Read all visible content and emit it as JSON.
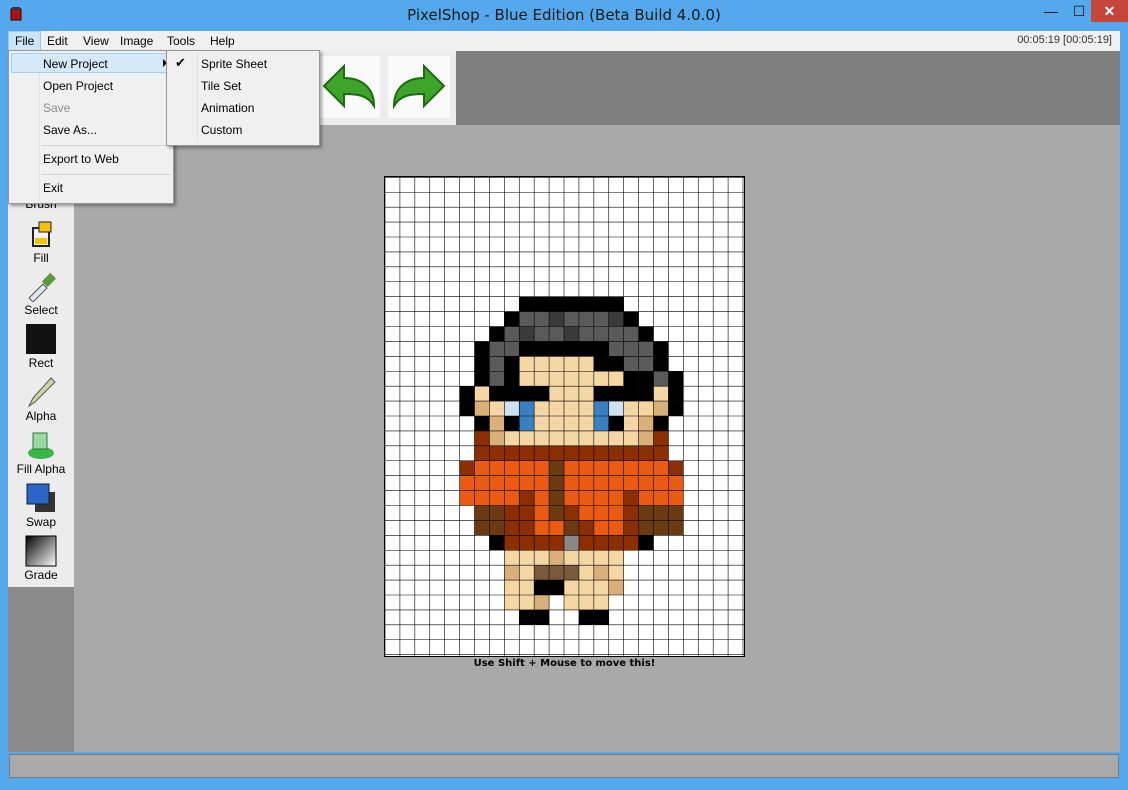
{
  "window": {
    "title": "PixelShop - Blue Edition (Beta Build 4.0.0)",
    "minimize_glyph": "—",
    "maximize_glyph": "☐",
    "close_glyph": "✕",
    "icon": "paint-bucket-icon"
  },
  "menubar": {
    "items": [
      "File",
      "Edit",
      "View",
      "Image",
      "Tools",
      "Help"
    ],
    "clock": "00:05:19 [00:05:19]"
  },
  "file_menu": {
    "items": [
      {
        "label": "New Project",
        "enabled": true,
        "has_submenu": true
      },
      {
        "label": "Open Project",
        "enabled": true
      },
      {
        "label": "Save",
        "enabled": false
      },
      {
        "label": "Save As...",
        "enabled": true
      },
      {
        "label": "Export to Web",
        "enabled": true
      },
      {
        "label": "Exit",
        "enabled": true
      }
    ]
  },
  "new_project_submenu": {
    "items": [
      {
        "label": "Sprite Sheet",
        "checked": true
      },
      {
        "label": "Tile Set",
        "checked": false
      },
      {
        "label": "Animation",
        "checked": false
      },
      {
        "label": "Custom",
        "checked": false
      }
    ],
    "check_glyph": "✔"
  },
  "toolbar": {
    "undo_icon": "undo-arrow-icon",
    "redo_icon": "redo-arrow-icon",
    "arrow_color": "#3fa52a"
  },
  "tools": [
    {
      "label": "Brush",
      "icon": "brush-icon"
    },
    {
      "label": "Fill",
      "icon": "paint-bucket-icon"
    },
    {
      "label": "Select",
      "icon": "eyedropper-icon"
    },
    {
      "label": "Rect",
      "icon": "rectangle-icon"
    },
    {
      "label": "Alpha",
      "icon": "pencil-icon"
    },
    {
      "label": "Fill Alpha",
      "icon": "green-bucket-icon"
    },
    {
      "label": "Swap",
      "icon": "swap-colors-icon"
    },
    {
      "label": "Grade",
      "icon": "gradient-icon"
    }
  ],
  "canvas": {
    "hint": "Use Shift + Mouse to move this!",
    "cols": 24,
    "rows": 32,
    "palette": {
      "K": "#000000",
      "G": "#5a5a5a",
      "g": "#3a3a3a",
      "S": "#f5d6a5",
      "s": "#d9b07a",
      "B": "#3a7fc0",
      "W": "#cfe0ef",
      "O": "#e85b10",
      "R": "#8b2e00",
      "D": "#6b3a10",
      "M": "#7a5a3a",
      "Y": "#888888"
    },
    "pixels": [
      "........................",
      "........................",
      "........................",
      "........................",
      "........................",
      "........................",
      "........................",
      "........................",
      ".........KKKKKKK........",
      "........KGGgGGGgK.......",
      ".......KGgGGgGGGGK......",
      "......KGGKKKKKKGGGK.....",
      "......KGKSSSSSKKGGK.....",
      "......KGKSSSSSSSKKGK....",
      ".....KSKKKKSSSKKKKSK....",
      ".....KsSWBSSSSBWSSsK....",
      "......KsKBSSSSBKSsK.....",
      "......RsSSSSSSSSSsR.....",
      "......RRRRRRRRRRRRR.....",
      ".....ROOOOODOOOOOOOR....",
      ".....OOOOOODOOOOOOOO....",
      ".....OOOORODOOOOROOO....",
      "......DDRRODROOORDDD....",
      "......DDRROODROORDDD....",
      ".......KRRRRYRRRRK......",
      "........SSSsSSSS........",
      "........sSMMMSsS........",
      "........SSKKSSSs........",
      "........SSs.SSS.........",
      ".........KK..KK.........",
      "........................",
      "........................"
    ]
  }
}
